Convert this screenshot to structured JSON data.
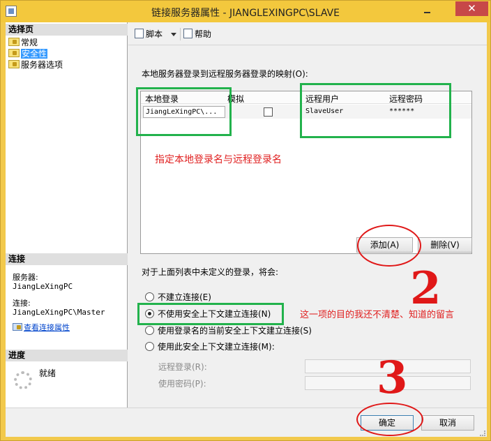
{
  "window": {
    "title": "链接服务器属性 - JIANGLEXINGPC\\SLAVE",
    "close_glyph": "✕"
  },
  "left": {
    "select_page_header": "选择页",
    "pages": [
      {
        "label": "常规",
        "selected": false
      },
      {
        "label": "安全性",
        "selected": true
      },
      {
        "label": "服务器选项",
        "selected": false
      }
    ],
    "connection_header": "连接",
    "server_label": "服务器:",
    "server_value": "JiangLeXingPC",
    "connection_label": "连接:",
    "connection_value": "JiangLeXingPC\\Master",
    "view_connection_link": "查看连接属性",
    "progress_header": "进度",
    "progress_status": "就绪"
  },
  "toolbar": {
    "script_label": "脚本",
    "help_label": "帮助"
  },
  "main": {
    "mapping_label": "本地服务器登录到远程服务器登录的映射(O):",
    "columns": {
      "local_login": "本地登录",
      "impersonate": "模拟",
      "remote_user": "远程用户",
      "remote_password": "远程密码"
    },
    "row": {
      "local_login": "JiangLeXingPC\\...",
      "impersonate": false,
      "remote_user": "SlaveUser",
      "remote_password": "******"
    },
    "annotation_mapping": "指定本地登录名与远程登录名",
    "add_button": "添加(A)",
    "remove_button": "删除(V)",
    "unlisted_label": "对于上面列表中未定义的登录，将会:",
    "options": [
      {
        "label": "不建立连接(E)",
        "selected": false
      },
      {
        "label": "不使用安全上下文建立连接(N)",
        "selected": true
      },
      {
        "label": "使用登录名的当前安全上下文建立连接(S)",
        "selected": false
      },
      {
        "label": "使用此安全上下文建立连接(M):",
        "selected": false
      }
    ],
    "annotation_option": "这一项的目的我还不清楚、知道的留言",
    "remote_login_label": "远程登录(R):",
    "remote_login_value": "",
    "password_label": "使用密码(P):",
    "password_value": "",
    "annotation_num2": "2",
    "annotation_num3": "3"
  },
  "footer": {
    "ok_button": "确定",
    "cancel_button": "取消"
  },
  "colors": {
    "title_bar": "#f3c83d",
    "selection": "#3399ff",
    "annotation_red": "#e01818",
    "annotation_green": "#22b24c"
  }
}
